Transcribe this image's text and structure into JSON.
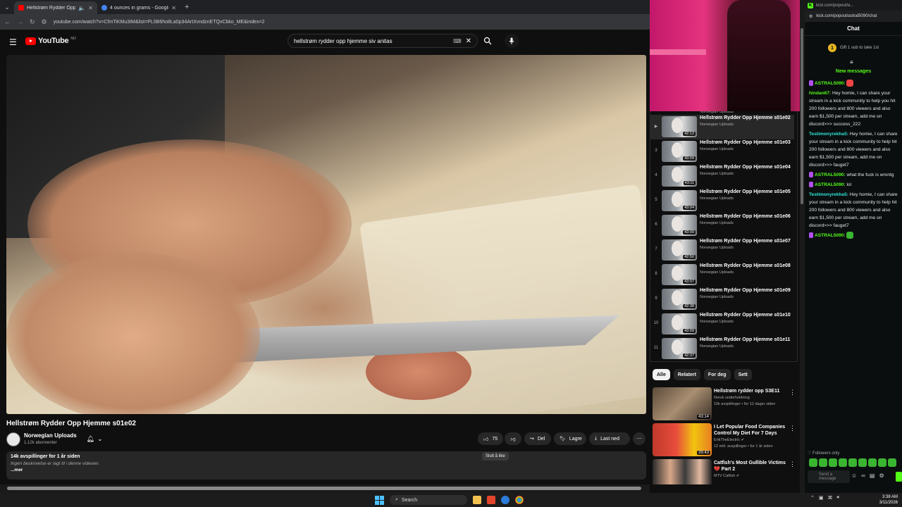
{
  "browser": {
    "tabs": [
      {
        "title": "Hellstrøm Rydder Opp Hje",
        "active": true
      },
      {
        "title": "4 ounces in grams - Google Se",
        "active": false
      }
    ],
    "url": "youtube.com/watch?v=CfmTiKMu3IM&list=PL0B6ho8La0p34ArtXvndznETQvCbko_ME&index=2"
  },
  "youtube": {
    "logo_text": "YouTube",
    "country_code": "NO",
    "search_query": "hellstrøm rydder opp hjemme siv anitas",
    "video_title": "Hellstrøm Rydder Opp Hjemme s01e02",
    "channel": {
      "name": "Norwegian Uploads",
      "subs": "1,12k abonnenter"
    },
    "actions": {
      "likes": "75",
      "share": "Del",
      "save": "Lagre",
      "download": "Last ned"
    },
    "tooltip": "Slutt å like",
    "description": {
      "views": "14k avspillinger  for 1 år siden",
      "text": "Ingen beskrivelse er lagt til i denne videoen.",
      "more": "...mer"
    }
  },
  "playlist": {
    "items": [
      {
        "idx": "▶",
        "title": "Hellstrøm Rydder Opp Hjemme s01e02",
        "channel": "Norwegian Uploads",
        "dur": "42:13",
        "active": true
      },
      {
        "idx": "3",
        "title": "Hellstrøm Rydder Opp Hjemme s01e03",
        "channel": "Norwegian Uploads",
        "dur": "43:09"
      },
      {
        "idx": "4",
        "title": "Hellstrøm Rydder Opp Hjemme s01e04",
        "channel": "Norwegian Uploads",
        "dur": "43:11"
      },
      {
        "idx": "5",
        "title": "Hellstrøm Rydder Opp Hjemme s01e05",
        "channel": "Norwegian Uploads",
        "dur": "43:04"
      },
      {
        "idx": "6",
        "title": "Hellstrøm Rydder Opp Hjemme s01e06",
        "channel": "Norwegian Uploads",
        "dur": "43:09"
      },
      {
        "idx": "7",
        "title": "Hellstrøm Rydder Opp Hjemme s01e07",
        "channel": "Norwegian Uploads",
        "dur": "42:50"
      },
      {
        "idx": "8",
        "title": "Hellstrøm Rydder Opp Hjemme s01e08",
        "channel": "Norwegian Uploads",
        "dur": "43:07"
      },
      {
        "idx": "9",
        "title": "Hellstrøm Rydder Opp Hjemme s01e09",
        "channel": "Norwegian Uploads",
        "dur": "42:38"
      },
      {
        "idx": "10",
        "title": "Hellstrøm Rydder Opp Hjemme s01e10",
        "channel": "Norwegian Uploads",
        "dur": "43:09"
      },
      {
        "idx": "11",
        "title": "Hellstrøm Rydder Opp Hjemme s01e11",
        "channel": "Norwegian Uploads",
        "dur": "42:37"
      }
    ]
  },
  "chips": [
    "Alle",
    "Relatert",
    "For deg",
    "Sett"
  ],
  "recommendations": [
    {
      "title": "Hellstrøm rydder opp S3E11",
      "channel": "Norsk underholdning",
      "meta": "10k avspillinger • for 12 dager siden",
      "dur": "43:14"
    },
    {
      "title": "I Let Popular Food Companies Control My Diet For 7 Days",
      "channel": "ErikTheElectric ✔",
      "meta": "12 mill. avspillinger • for 1 år siden",
      "dur": "39:43"
    },
    {
      "title": "Catfish's Most Gullible Victims 💔 Part 2",
      "channel": "MTV Catfish ✔",
      "meta": "",
      "dur": ""
    }
  ],
  "kick": {
    "tab": "kick.com/popout/a...",
    "url": "kick.com/popout/astral5090/chat",
    "header": "Chat",
    "gift_count": "1",
    "gift_text": "Gift 1 sub to take 1st",
    "new_messages": "New messages",
    "messages": [
      {
        "user": "ASTRAL5090:",
        "color": "#53fc18",
        "badge": true,
        "text": "",
        "emote": "#e44"
      },
      {
        "user": "hindan67:",
        "color": "#53fc18",
        "badge": false,
        "text": "Hey homie, I can share your stream in a kick community to help you hit 200 followers and 800 viewers and also earn $1,500 per stream, add me on discord>>> success_222"
      },
      {
        "user": "Testimonyrekha5:",
        "color": "#2ee6d6",
        "badge": false,
        "text": "Hey homie, I can share your stream in a kick community to help hit 200 followers and 800 viewers and also earn $1,500 per stream, add me on discord>>> fauget7"
      },
      {
        "user": "ASTRAL5090:",
        "color": "#53fc18",
        "badge": true,
        "text": "what the fuck is wrontg"
      },
      {
        "user": "ASTRAL5090:",
        "color": "#53fc18",
        "badge": true,
        "text": "lol"
      },
      {
        "user": "Testimonyrekha5:",
        "color": "#2ee6d6",
        "badge": false,
        "text": "Hey homie, I can share your stream in a kick community to help hit 200 followers and 800 viewers and also earn $1,500 per stream, add me on discord>>> fauget7"
      },
      {
        "user": "ASTRAL5090:",
        "color": "#53fc18",
        "badge": true,
        "text": "",
        "emote": "#3ab531"
      }
    ],
    "followers_only": "Followers only",
    "input_placeholder": "Send a message"
  },
  "taskbar": {
    "search": "Search",
    "time": "3:38 AM",
    "date": "3/11/2026"
  }
}
